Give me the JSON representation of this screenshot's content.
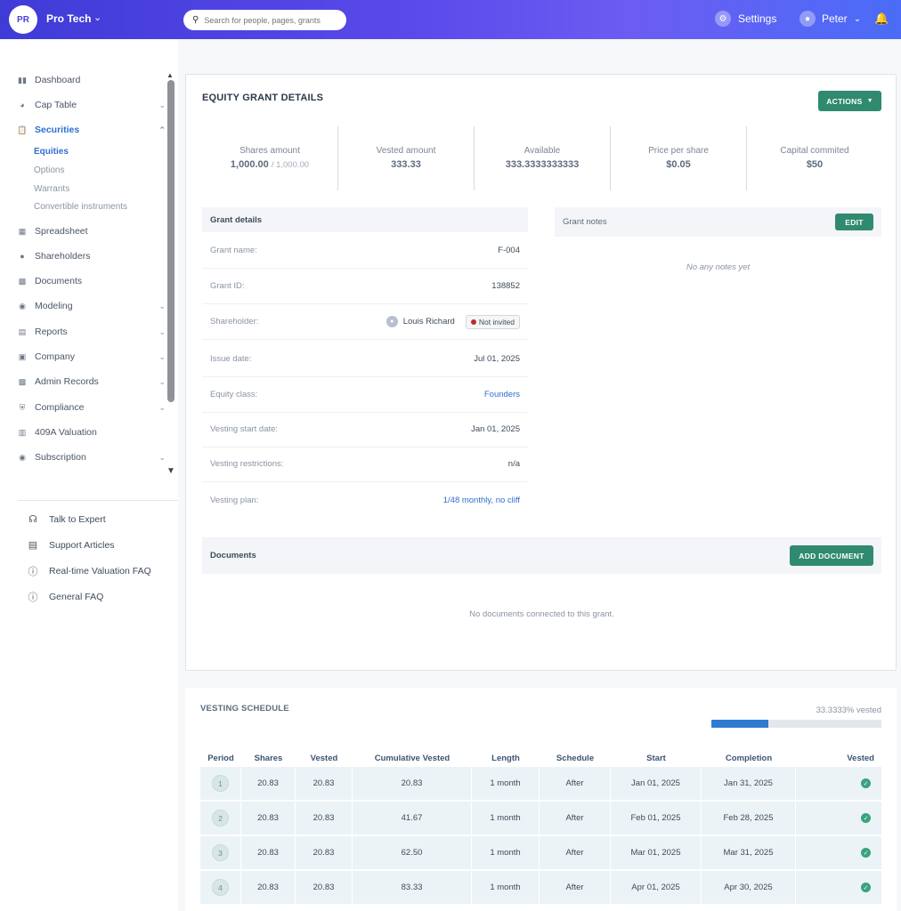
{
  "topbar": {
    "org_initials": "PR",
    "org_name": "Pro Tech",
    "search_placeholder": "Search for people, pages, grants",
    "settings_label": "Settings",
    "user_name": "Peter"
  },
  "sidebar": {
    "items": [
      {
        "label": "Dashboard",
        "icon": "dashboard-icon"
      },
      {
        "label": "Cap Table",
        "icon": "pie-chart-icon"
      },
      {
        "label": "Securities",
        "icon": "clipboard-icon"
      },
      {
        "label": "Spreadsheet",
        "icon": "spreadsheet-icon"
      },
      {
        "label": "Shareholders",
        "icon": "person-icon"
      },
      {
        "label": "Documents",
        "icon": "folder-icon"
      },
      {
        "label": "Modeling",
        "icon": "bulb-icon"
      },
      {
        "label": "Reports",
        "icon": "report-icon"
      },
      {
        "label": "Company",
        "icon": "building-icon"
      },
      {
        "label": "Admin Records",
        "icon": "records-icon"
      },
      {
        "label": "Compliance",
        "icon": "shield-icon"
      },
      {
        "label": "409A Valuation",
        "icon": "chart-icon"
      },
      {
        "label": "Subscription",
        "icon": "dollar-icon"
      }
    ],
    "securities_sub": [
      "Equities",
      "Options",
      "Warrants",
      "Convertible instruments"
    ],
    "help": [
      {
        "label": "Talk to Expert",
        "icon": "headset-icon"
      },
      {
        "label": "Support Articles",
        "icon": "book-icon"
      },
      {
        "label": "Real-time Valuation FAQ",
        "icon": "question-icon"
      },
      {
        "label": "General FAQ",
        "icon": "question-icon"
      }
    ]
  },
  "grant": {
    "title": "EQUITY GRANT DETAILS",
    "actions_label": "ACTIONS",
    "stats": [
      {
        "label": "Shares amount",
        "value": "1,000.00",
        "sub": "/ 1,000.00"
      },
      {
        "label": "Vested amount",
        "value": "333.33"
      },
      {
        "label": "Available",
        "value": "333.3333333333"
      },
      {
        "label": "Price per share",
        "value": "$0.05"
      },
      {
        "label": "Capital commited",
        "value": "$50"
      }
    ],
    "details_title": "Grant details",
    "details": [
      {
        "key": "Grant name:",
        "value": "F-004"
      },
      {
        "key": "Grant ID:",
        "value": "138852"
      },
      {
        "key": "Shareholder:",
        "value": "Louis Richard",
        "badge": "Not invited"
      },
      {
        "key": "Issue date:",
        "value": "Jul 01, 2025"
      },
      {
        "key": "Equity class:",
        "value": "Founders"
      },
      {
        "key": "Vesting start date:",
        "value": "Jan 01, 2025"
      },
      {
        "key": "Vesting restrictions:",
        "value": "n/a"
      },
      {
        "key": "Vesting plan:",
        "value": "1/48 monthly, no cliff"
      }
    ],
    "notes_title": "Grant notes",
    "notes_edit_label": "EDIT",
    "notes_empty": "No any notes yet",
    "documents_title": "Documents",
    "add_document_label": "ADD DOCUMENT",
    "documents_empty": "No documents connected to this grant."
  },
  "vesting": {
    "title": "VESTING SCHEDULE",
    "percent_label": "33.3333% vested",
    "percent_value": 33.3333,
    "columns": [
      "Period",
      "Shares",
      "Vested",
      "Cumulative Vested",
      "Length",
      "Schedule",
      "Start",
      "Completion",
      "Vested"
    ],
    "rows": [
      {
        "period": "1",
        "shares": "20.83",
        "vested": "20.83",
        "cumulative": "20.83",
        "length": "1 month",
        "schedule": "After",
        "start": "Jan 01, 2025",
        "completion": "Jan 31, 2025"
      },
      {
        "period": "2",
        "shares": "20.83",
        "vested": "20.83",
        "cumulative": "41.67",
        "length": "1 month",
        "schedule": "After",
        "start": "Feb 01, 2025",
        "completion": "Feb 28, 2025"
      },
      {
        "period": "3",
        "shares": "20.83",
        "vested": "20.83",
        "cumulative": "62.50",
        "length": "1 month",
        "schedule": "After",
        "start": "Mar 01, 2025",
        "completion": "Mar 31, 2025"
      },
      {
        "period": "4",
        "shares": "20.83",
        "vested": "20.83",
        "cumulative": "83.33",
        "length": "1 month",
        "schedule": "After",
        "start": "Apr 01, 2025",
        "completion": "Apr 30, 2025"
      }
    ]
  },
  "colors": {
    "brand": "#4a43d8",
    "accent_green": "#2f8a6f",
    "link": "#2f6fd0",
    "progress": "#2f7bd1"
  }
}
